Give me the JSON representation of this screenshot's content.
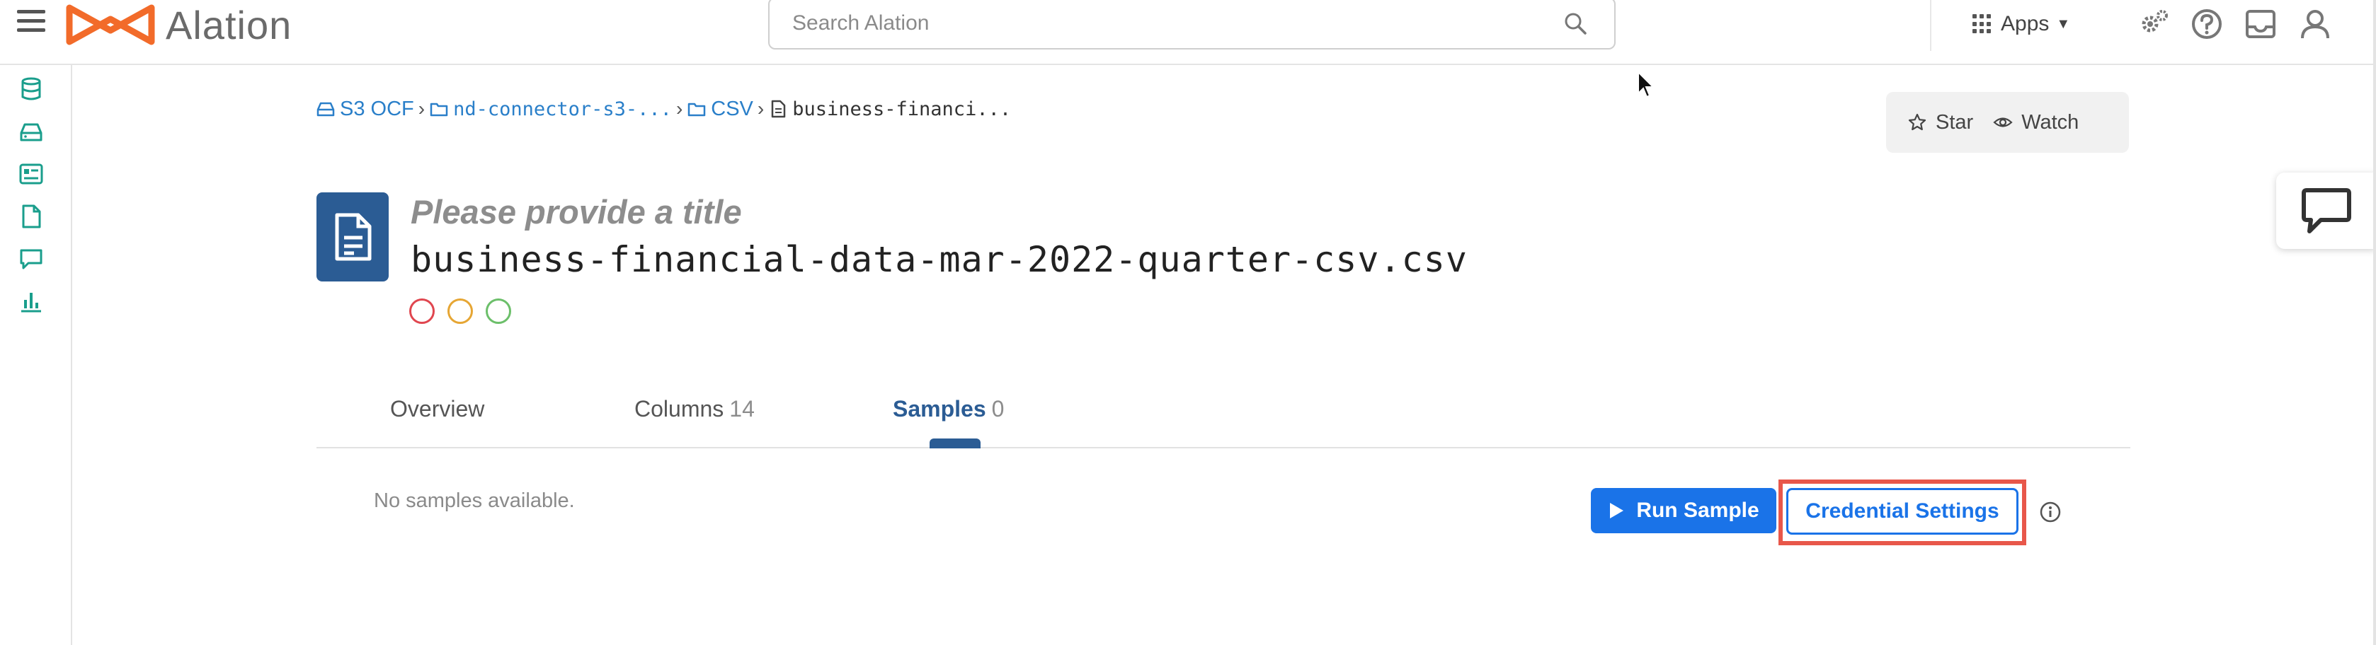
{
  "app": {
    "name": "Alation"
  },
  "search": {
    "placeholder": "Search Alation"
  },
  "header": {
    "apps_label": "Apps"
  },
  "breadcrumb": [
    {
      "label": "S3 OCF",
      "icon": "storage-icon"
    },
    {
      "label": "nd-connector-s3-...",
      "icon": "folder-icon"
    },
    {
      "label": "CSV",
      "icon": "folder-icon"
    },
    {
      "label": "business-financi...",
      "icon": "file-icon"
    }
  ],
  "actions": {
    "star": "Star",
    "watch": "Watch"
  },
  "page": {
    "title_placeholder": "Please provide a title",
    "file_name": "business-financial-data-mar-2022-quarter-csv.csv"
  },
  "trust_flags": [
    {
      "color": "#e0464f"
    },
    {
      "color": "#e6a634"
    },
    {
      "color": "#6cbf6a"
    }
  ],
  "tabs": [
    {
      "label": "Overview",
      "count": ""
    },
    {
      "label": "Columns",
      "count": "14"
    },
    {
      "label": "Samples",
      "count": "0",
      "active": true
    }
  ],
  "samples": {
    "empty_message": "No samples available.",
    "run_sample": "Run Sample",
    "credential_settings": "Credential Settings"
  },
  "colors": {
    "brand_orange": "#f26b2a",
    "primary_blue": "#1a73e8",
    "nav_teal": "#1a9e8c",
    "tile_blue": "#2b5c94",
    "highlight_red": "#e8574a"
  }
}
